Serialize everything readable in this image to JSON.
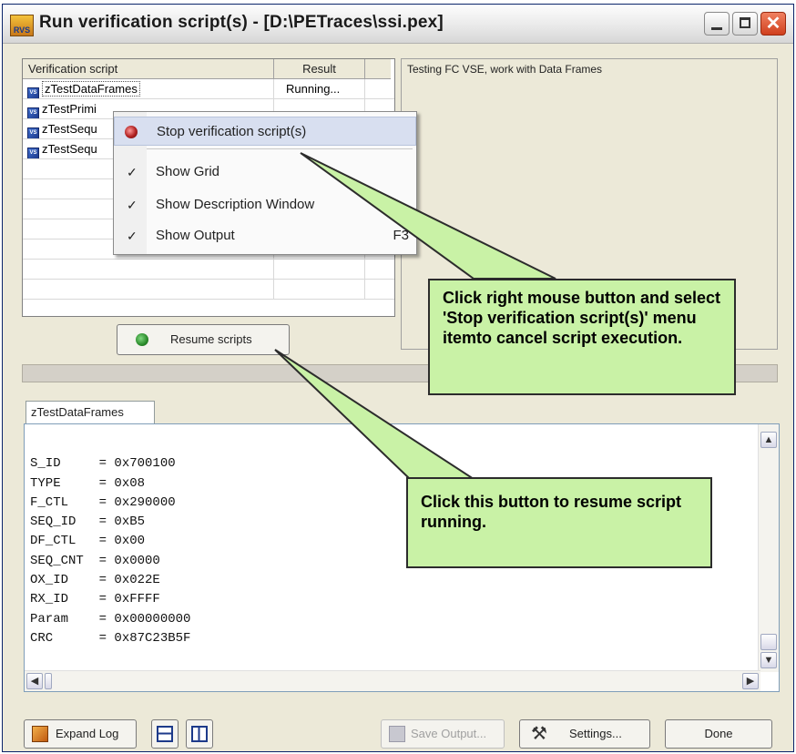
{
  "window": {
    "title": "Run verification script(s) -  [D:\\PETraces\\ssi.pex]",
    "app_icon_text": "RVS"
  },
  "grid": {
    "columns": [
      "Verification script",
      "Result"
    ],
    "rows": [
      {
        "name": "zTestDataFrames",
        "result": "Running..."
      },
      {
        "name": "zTestPrimi",
        "result": ""
      },
      {
        "name": "zTestSequ",
        "result": ""
      },
      {
        "name": "zTestSequ",
        "result": ""
      }
    ]
  },
  "description": {
    "text": "Testing FC VSE, work with Data Frames"
  },
  "context_menu": {
    "items": [
      {
        "label": "Stop verification script(s)",
        "checked": false,
        "shortcut": ""
      },
      {
        "label": "Show Grid",
        "checked": true,
        "shortcut": ""
      },
      {
        "label": "Show Description Window",
        "checked": true,
        "shortcut": ""
      },
      {
        "label": "Show Output",
        "checked": true,
        "shortcut": "F3"
      }
    ],
    "check_glyph": "✓"
  },
  "resume_button": {
    "label": "Resume scripts"
  },
  "output_tab": {
    "label": "zTestDataFrames"
  },
  "output_lines": [
    "S_ID     = 0x700100",
    "TYPE     = 0x08",
    "F_CTL    = 0x290000",
    "SEQ_ID   = 0xB5",
    "DF_CTL   = 0x00",
    "SEQ_CNT  = 0x0000",
    "OX_ID    = 0x022E",
    "RX_ID    = 0xFFFF",
    "Param    = 0x00000000",
    "CRC      = 0x87C23B5F"
  ],
  "callouts": {
    "stop": "Click right mouse button and select 'Stop verification script(s)' menu itemto cancel script execution.",
    "resume": "Click this button to resume script running."
  },
  "bottom_bar": {
    "expand_log": "Expand Log",
    "save_output": "Save Output...",
    "settings": "Settings...",
    "done": "Done"
  },
  "colors": {
    "callout_bg": "#c9f2a6",
    "stop_icon": "#b02020",
    "resume_icon": "#2a8a2a"
  }
}
